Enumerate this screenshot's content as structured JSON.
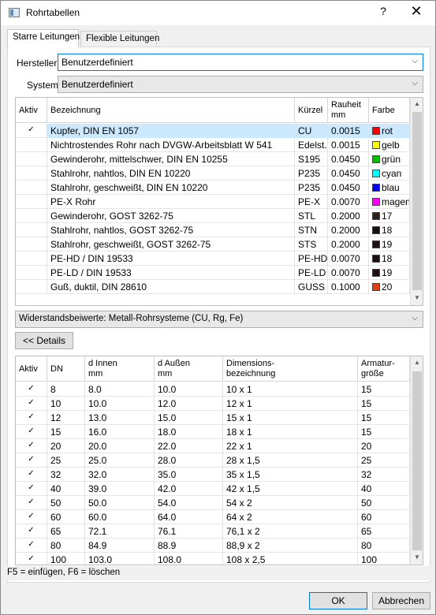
{
  "window": {
    "title": "Rohrtabellen",
    "help_glyph": "?",
    "close_glyph": "✕"
  },
  "tabs": [
    {
      "label": "Starre Leitungen",
      "active": true
    },
    {
      "label": "Flexible Leitungen",
      "active": false
    }
  ],
  "filters": {
    "manufacturer_label": "Hersteller",
    "manufacturer_value": "Benutzerdefiniert",
    "system_label": "System",
    "system_value": "Benutzerdefiniert"
  },
  "pipes": {
    "headers": {
      "active": "Aktiv",
      "name": "Bezeichnung",
      "short": "Kürzel",
      "roughness": "Rauheit",
      "roughness_unit": "mm",
      "color": "Farbe"
    },
    "rows": [
      {
        "active": "✓",
        "name": "Kupfer, DIN EN 1057",
        "short": "CU",
        "roughness": "0.0015",
        "color": "rot",
        "swatch": "#ff0000"
      },
      {
        "active": "",
        "name": "Nichtrostendes Rohr nach DVGW-Arbeitsblatt W 541",
        "short": "Edelst...",
        "roughness": "0.0015",
        "color": "gelb",
        "swatch": "#ffff00"
      },
      {
        "active": "",
        "name": "Gewinderohr, mittelschwer, DIN EN 10255",
        "short": "S195",
        "roughness": "0.0450",
        "color": "grün",
        "swatch": "#00c000"
      },
      {
        "active": "",
        "name": "Stahlrohr, nahtlos, DIN EN 10220",
        "short": "P235",
        "roughness": "0.0450",
        "color": "cyan",
        "swatch": "#00ffff"
      },
      {
        "active": "",
        "name": "Stahlrohr, geschweißt, DIN EN 10220",
        "short": "P235",
        "roughness": "0.0450",
        "color": "blau",
        "swatch": "#0000ff"
      },
      {
        "active": "",
        "name": "PE-X Rohr",
        "short": "PE-X",
        "roughness": "0.0070",
        "color": "magent",
        "swatch": "#ff00ff"
      },
      {
        "active": "",
        "name": "Gewinderohr, GOST 3262-75",
        "short": "STL",
        "roughness": "0.2000",
        "color": "17",
        "swatch": "#2e1f1a"
      },
      {
        "active": "",
        "name": "Stahlrohr, nahtlos, GOST 3262-75",
        "short": "STN",
        "roughness": "0.2000",
        "color": "18",
        "swatch": "#1a1010"
      },
      {
        "active": "",
        "name": "Stahlrohr, geschweißt,  GOST 3262-75",
        "short": "STS",
        "roughness": "0.2000",
        "color": "19",
        "swatch": "#201010"
      },
      {
        "active": "",
        "name": "PE-HD / DIN 19533",
        "short": "PE-HD",
        "roughness": "0.0070",
        "color": "18",
        "swatch": "#1a1010"
      },
      {
        "active": "",
        "name": "PE-LD / DIN 19533",
        "short": "PE-LD",
        "roughness": "0.0070",
        "color": "19",
        "swatch": "#201010"
      },
      {
        "active": "",
        "name": "Guß, duktil, DIN 28610",
        "short": "GUSS",
        "roughness": "0.1000",
        "color": "20",
        "swatch": "#e04010"
      }
    ]
  },
  "resistance": {
    "value": "Widerstandsbeiwerte: Metall-Rohrsysteme (CU, Rg, Fe)"
  },
  "details_button": "<< Details",
  "dims": {
    "headers": {
      "active": "Aktiv",
      "dn": "DN",
      "d_inner": "d Innen",
      "d_inner_unit": "mm",
      "d_outer": "d Außen",
      "d_outer_unit": "mm",
      "dim_name_1": "Dimensions-",
      "dim_name_2": "bezeichnung",
      "fitting_1": "Armatur-",
      "fitting_2": "größe"
    },
    "rows": [
      {
        "active": "✓",
        "dn": "8",
        "di": "8.0",
        "da": "10.0",
        "name": "10 x 1",
        "fit": "15"
      },
      {
        "active": "✓",
        "dn": "10",
        "di": "10.0",
        "da": "12.0",
        "name": "12 x 1",
        "fit": "15"
      },
      {
        "active": "✓",
        "dn": "12",
        "di": "13.0",
        "da": "15.0",
        "name": "15 x 1",
        "fit": "15"
      },
      {
        "active": "✓",
        "dn": "15",
        "di": "16.0",
        "da": "18.0",
        "name": "18 x 1",
        "fit": "15"
      },
      {
        "active": "✓",
        "dn": "20",
        "di": "20.0",
        "da": "22.0",
        "name": "22 x 1",
        "fit": "20"
      },
      {
        "active": "✓",
        "dn": "25",
        "di": "25.0",
        "da": "28.0",
        "name": "28 x 1,5",
        "fit": "25"
      },
      {
        "active": "✓",
        "dn": "32",
        "di": "32.0",
        "da": "35.0",
        "name": "35 x 1,5",
        "fit": "32"
      },
      {
        "active": "✓",
        "dn": "40",
        "di": "39.0",
        "da": "42.0",
        "name": "42 x 1,5",
        "fit": "40"
      },
      {
        "active": "✓",
        "dn": "50",
        "di": "50.0",
        "da": "54.0",
        "name": "54 x 2",
        "fit": "50"
      },
      {
        "active": "✓",
        "dn": "60",
        "di": "60.0",
        "da": "64.0",
        "name": "64 x 2",
        "fit": "60"
      },
      {
        "active": "✓",
        "dn": "65",
        "di": "72.1",
        "da": "76.1",
        "name": "76,1 x 2",
        "fit": "65"
      },
      {
        "active": "✓",
        "dn": "80",
        "di": "84.9",
        "da": "88.9",
        "name": "88,9 x 2",
        "fit": "80"
      },
      {
        "active": "✓",
        "dn": "100",
        "di": "103.0",
        "da": "108.0",
        "name": "108 x 2,5",
        "fit": "100"
      }
    ]
  },
  "hint": "F5 = einfügen,  F6 = löschen",
  "buttons": {
    "ok": "OK",
    "cancel": "Abbrechen"
  }
}
